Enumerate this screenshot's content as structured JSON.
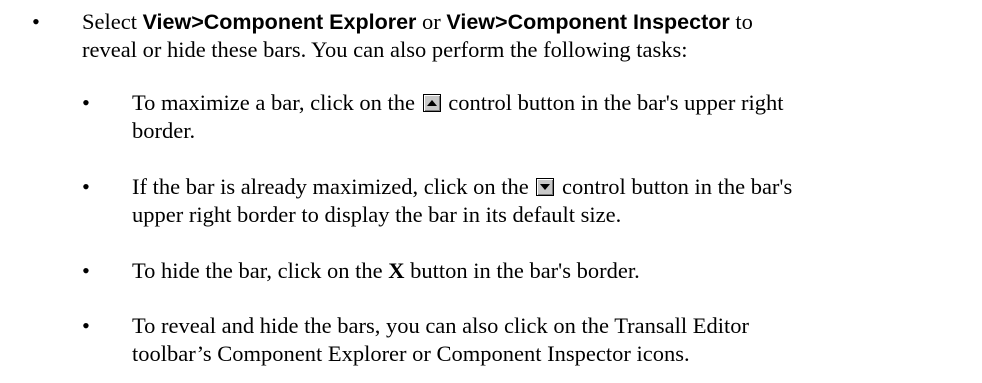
{
  "main_item": {
    "bullet": "•",
    "t1": "Select ",
    "b1": "View>Component Explorer",
    "t2": " or ",
    "b2": "View>Component Inspector",
    "t3": " to",
    "line2": "reveal or hide these bars. You can also perform the following tasks:"
  },
  "sub_items": [
    {
      "bullet": "•",
      "t1": "To maximize a bar, click on the ",
      "icon": "maximize-icon",
      "t2": " control button in the bar's upper right",
      "line2": "border."
    },
    {
      "bullet": "•",
      "t1": "If the bar is already maximized, click on the ",
      "icon": "restore-icon",
      "t2": " control button in the bar's",
      "line2": "upper right border to display the bar in its default size."
    },
    {
      "bullet": "•",
      "t1": "To hide the bar, click on the ",
      "bold": "X",
      "t2": " button in the bar's border."
    },
    {
      "bullet": "•",
      "line1": "To reveal and hide the bars, you can also click on the Transall Editor",
      "line2": "toolbar’s Component Explorer or Component Inspector icons."
    }
  ]
}
